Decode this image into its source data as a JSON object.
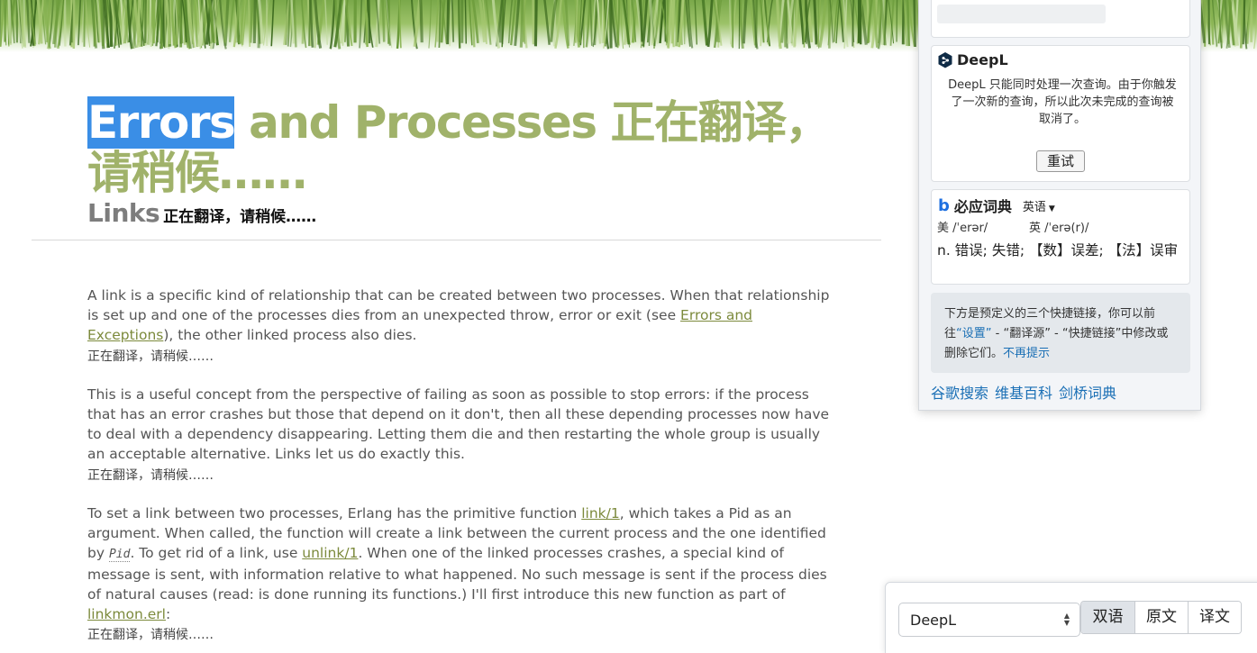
{
  "article": {
    "title_selected": "Errors",
    "title_rest": " and Processes",
    "title_translating": "正在翻译，请稍候……",
    "subtitle": "Links",
    "subtitle_translating": "正在翻译，请稍候……",
    "translating_placeholder": "正在翻译，请稍候……",
    "p1": {
      "before": "A link is a specific kind of relationship that can be created between two processes. When that relationship is set up and one of the processes dies from an unexpected throw, error or exit (see ",
      "link": "Errors and Exceptions",
      "after": "), the other linked process also dies."
    },
    "p2": "This is a useful concept from the perspective of failing as soon as possible to stop errors: if the process that has an error crashes but those that depend on it don't, then all these depending processes now have to deal with a dependency disappearing. Letting them die and then restarting the whole group is usually an acceptable alternative. Links let us do exactly this.",
    "p3": {
      "a": "To set a link between two processes, Erlang has the primitive function ",
      "link1": "link/1",
      "b": ", which takes a Pid as an argument. When called, the function will create a link between the current process and the one identified by ",
      "code": "Pid",
      "c": ". To get rid of a link, use ",
      "link2": "unlink/1",
      "d": ". When one of the linked processes crashes, a special kind of message is sent, with information relative to what happened. No such message is sent if the process dies of natural causes (read: is done running its functions.) I'll first introduce this new function as part of ",
      "link3": "linkmon.erl",
      "e": ":"
    }
  },
  "popup": {
    "deepl": {
      "name": "DeepL",
      "message": "DeepL 只能同时处理一次查询。由于你触发了一次新的查询，所以此次未完成的查询被取消了。",
      "retry_label": "重试"
    },
    "bing": {
      "icon_letter": "b",
      "name": "必应词典",
      "lang": "英语",
      "us_label": "美",
      "us_phonetic": "/ˈerər/",
      "uk_label": "英",
      "uk_phonetic": "/ˈerə(r)/",
      "definition": "n. 错误; 失错; 【数】误差; 【法】误审"
    },
    "tip": {
      "text1": "下方是预定义的三个快捷链接，你可以前往",
      "settings_link": "“设置”",
      "text2": " - “翻译源” - “快捷链接”中修改或删除它们。",
      "dismiss_link": "不再提示"
    },
    "quick_links": [
      "谷歌搜索",
      "维基百科",
      "剑桥词典"
    ]
  },
  "translate_bar": {
    "engine": "DeepL",
    "modes": [
      "双语",
      "原文",
      "译文"
    ],
    "active_mode": "双语"
  },
  "colors": {
    "title": "#a0b26a",
    "selection": "#3a8ee6",
    "link": "#7c8a3c",
    "popup_link": "#1a6fb5"
  }
}
